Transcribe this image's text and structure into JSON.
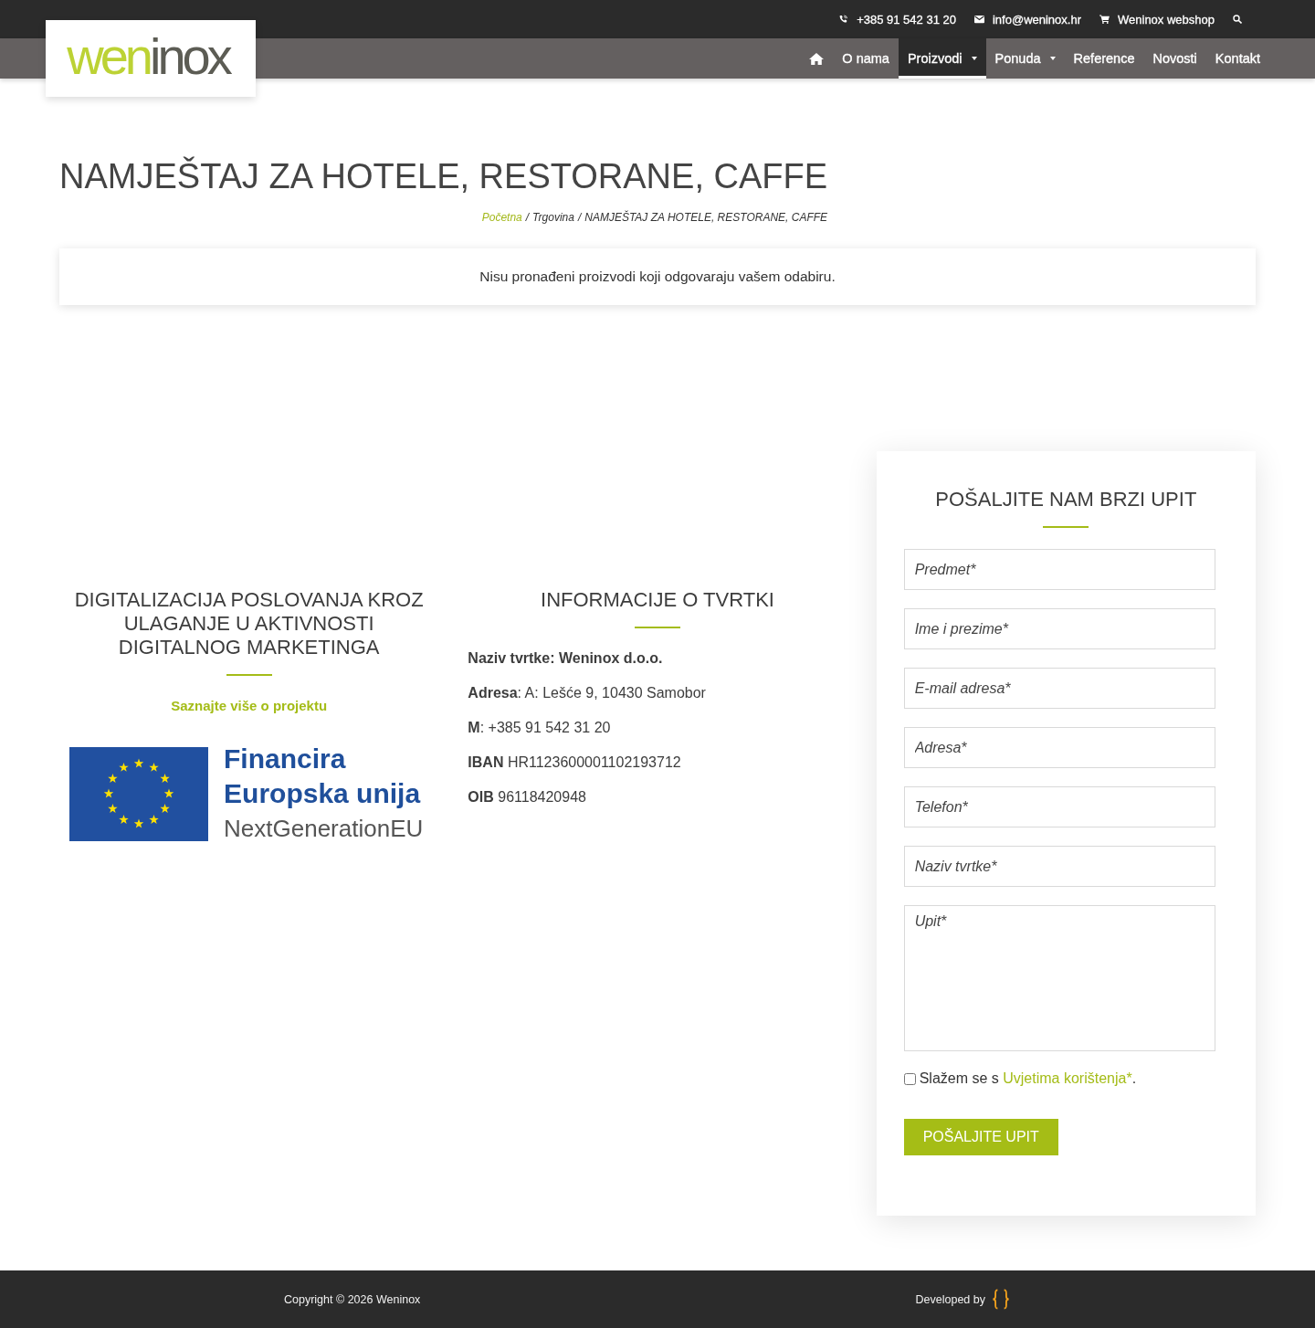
{
  "top_bar": {
    "contacts": [
      {
        "kind": "phone",
        "label": "+385 91 542 31 20"
      },
      {
        "kind": "email",
        "label": "info@weninox.hr"
      },
      {
        "kind": "cart",
        "label": "Weninox webshop"
      }
    ]
  },
  "logo": {
    "accent": "wen",
    "rest": "inox"
  },
  "nav": {
    "items": [
      {
        "kind": "home",
        "selected": false
      },
      {
        "kind": "link",
        "label": "O nama",
        "selected": false,
        "submenu": false
      },
      {
        "kind": "link",
        "label": "Proizvodi",
        "selected": true,
        "submenu": true
      },
      {
        "kind": "link",
        "label": "Ponuda",
        "selected": false,
        "submenu": true
      },
      {
        "kind": "link",
        "label": "Reference",
        "selected": false,
        "submenu": false
      },
      {
        "kind": "link",
        "label": "Novosti",
        "selected": false,
        "submenu": false
      },
      {
        "kind": "link",
        "label": "Kontakt",
        "selected": false,
        "submenu": false
      }
    ]
  },
  "page_title": "NAMJEŠTAJ ZA HOTELE, RESTORANE, CAFFE",
  "breadcrumb": {
    "separator": "/",
    "items": [
      {
        "kind": "link",
        "label": "Početna"
      },
      {
        "kind": "text",
        "label": "Trgovina"
      },
      {
        "kind": "text",
        "label": "NAMJEŠTAJ ZA HOTELE, RESTORANE, CAFFE"
      }
    ]
  },
  "notice": "Nisu pronađeni proizvodi koji odgovaraju vašem odabiru.",
  "project": {
    "heading": "DIGITALIZACIJA POSLOVANJA KROZ ULAGANJE U AKTIVNOSTI DIGITALNOG MARKETINGA",
    "link": "Saznajte više o projektu",
    "eu_logo": {
      "lines": [
        {
          "kind": "strong",
          "text": "Financira"
        },
        {
          "kind": "strong",
          "text": "Europska unija"
        },
        {
          "kind": "plain",
          "text": "NextGenerationEU"
        }
      ]
    }
  },
  "company": {
    "heading": "INFORMACIJE O TVRTKI",
    "rows": [
      {
        "text": "Naziv tvrtke: Weninox d.o.o.",
        "bold": true
      },
      {
        "text": "**Adresa**: A: Lešće 9, 10430 Samobor",
        "bold": false
      },
      {
        "text": "**M**: +385 91 542 31 20",
        "bold": false
      },
      {
        "text": "**IBAN** HR1123600001102193712",
        "bold": false
      },
      {
        "text": "**OIB** 96118420948",
        "bold": false
      }
    ]
  },
  "form": {
    "heading": "POŠALJITE NAM BRZI UPIT",
    "fields": [
      {
        "kind": "input",
        "placeholder": "Predmet*"
      },
      {
        "kind": "input",
        "placeholder": "Ime i prezime*"
      },
      {
        "kind": "input",
        "placeholder": "E-mail adresa*"
      },
      {
        "kind": "input",
        "placeholder": "Adresa*"
      },
      {
        "kind": "input",
        "placeholder": "Telefon*"
      },
      {
        "kind": "input",
        "placeholder": "Naziv tvrtke*"
      },
      {
        "kind": "textarea",
        "placeholder": "Upit*"
      }
    ],
    "consent": {
      "checked": false,
      "text_before": "Slažem se s",
      "link": "Uvjetima korištenja*",
      "text_after": "."
    },
    "submit": "POŠALJITE UPIT"
  },
  "footer": {
    "copyright": "Copyright © 2026 Weninox",
    "credit": "Developed by"
  }
}
